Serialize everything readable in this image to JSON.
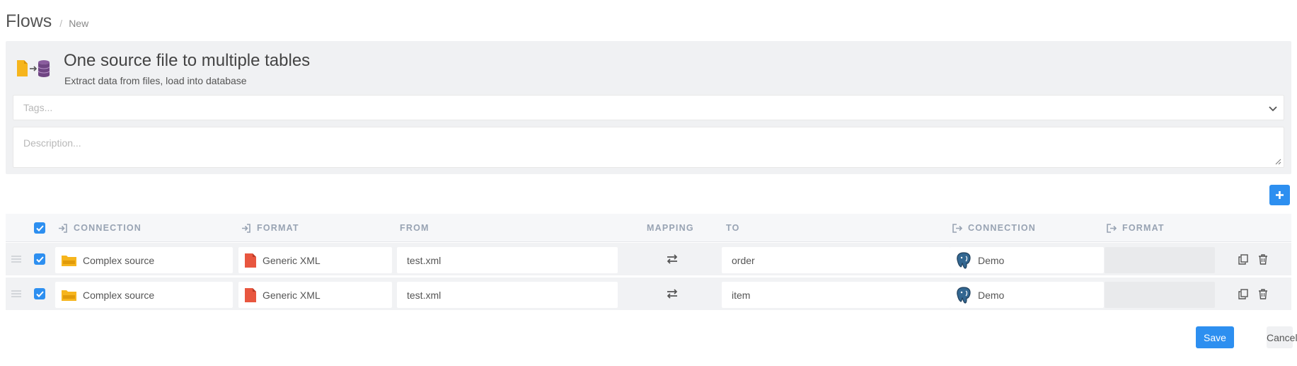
{
  "breadcrumb": {
    "title": "Flows",
    "separator": "/",
    "current": "New"
  },
  "flow": {
    "title": "One source file to multiple tables",
    "subtitle": "Extract data from files, load into database",
    "icon": "file-to-database-icon"
  },
  "tags": {
    "placeholder": "Tags..."
  },
  "description": {
    "placeholder": "Description..."
  },
  "colors": {
    "accent": "#2d8ff0",
    "header_text": "#98a3b3",
    "panel_bg": "#f0f1f3"
  },
  "table": {
    "headers": {
      "source_connection": "CONNECTION",
      "source_format": "FORMAT",
      "from": "FROM",
      "mapping": "MAPPING",
      "to": "TO",
      "target_connection": "CONNECTION",
      "target_format": "FORMAT"
    },
    "rows": [
      {
        "checked": true,
        "source_connection": "Complex source",
        "source_format": "Generic XML",
        "from": "test.xml",
        "to": "order",
        "target_connection": "Demo",
        "target_format": ""
      },
      {
        "checked": true,
        "source_connection": "Complex source",
        "source_format": "Generic XML",
        "from": "test.xml",
        "to": "item",
        "target_connection": "Demo",
        "target_format": ""
      }
    ]
  },
  "actions": {
    "save": "Save",
    "cancel": "Cancel"
  }
}
